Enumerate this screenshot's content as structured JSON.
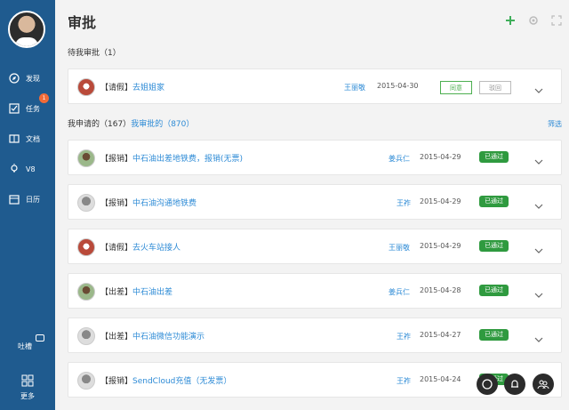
{
  "sidebar": {
    "items": [
      {
        "label": "发现"
      },
      {
        "label": "任务",
        "badge": "1"
      },
      {
        "label": "文档"
      },
      {
        "label": "V8"
      },
      {
        "label": "日历"
      }
    ],
    "tucao": "吐槽",
    "more": "更多"
  },
  "page": {
    "title": "审批"
  },
  "pending": {
    "title": "待我审批（1）",
    "item": {
      "type": "【请假】",
      "title": "去姐姐家",
      "person": "王丽敬",
      "date": "2015-04-30",
      "approve": "同意",
      "reject": "驳回"
    }
  },
  "mine": {
    "title_prefix": "我申请的（167）",
    "title_link": "我审批的（870）",
    "filter": "筛选",
    "items": [
      {
        "type": "【报销】",
        "title": "中石油出差地铁费，报销(无票)",
        "person": "姜兵仁",
        "date": "2015-04-29",
        "status": "已通过"
      },
      {
        "type": "【报销】",
        "title": "中石油沟通地铁费",
        "person": "王祚",
        "date": "2015-04-29",
        "status": "已通过"
      },
      {
        "type": "【请假】",
        "title": "去火车站接人",
        "person": "王丽敬",
        "date": "2015-04-29",
        "status": "已通过"
      },
      {
        "type": "【出差】",
        "title": "中石油出差",
        "person": "姜兵仁",
        "date": "2015-04-28",
        "status": "已通过"
      },
      {
        "type": "【出差】",
        "title": "中石油微信功能演示",
        "person": "王祚",
        "date": "2015-04-27",
        "status": "已通过"
      },
      {
        "type": "【报销】",
        "title": "SendCloud充值（无发票）",
        "person": "王祚",
        "date": "2015-04-24",
        "status": "已通过"
      }
    ]
  },
  "colors": {
    "sidebar": "#1f5b8f",
    "accent": "#2e8bd6",
    "status_green": "#2f9a3f",
    "badge": "#f26b38"
  }
}
